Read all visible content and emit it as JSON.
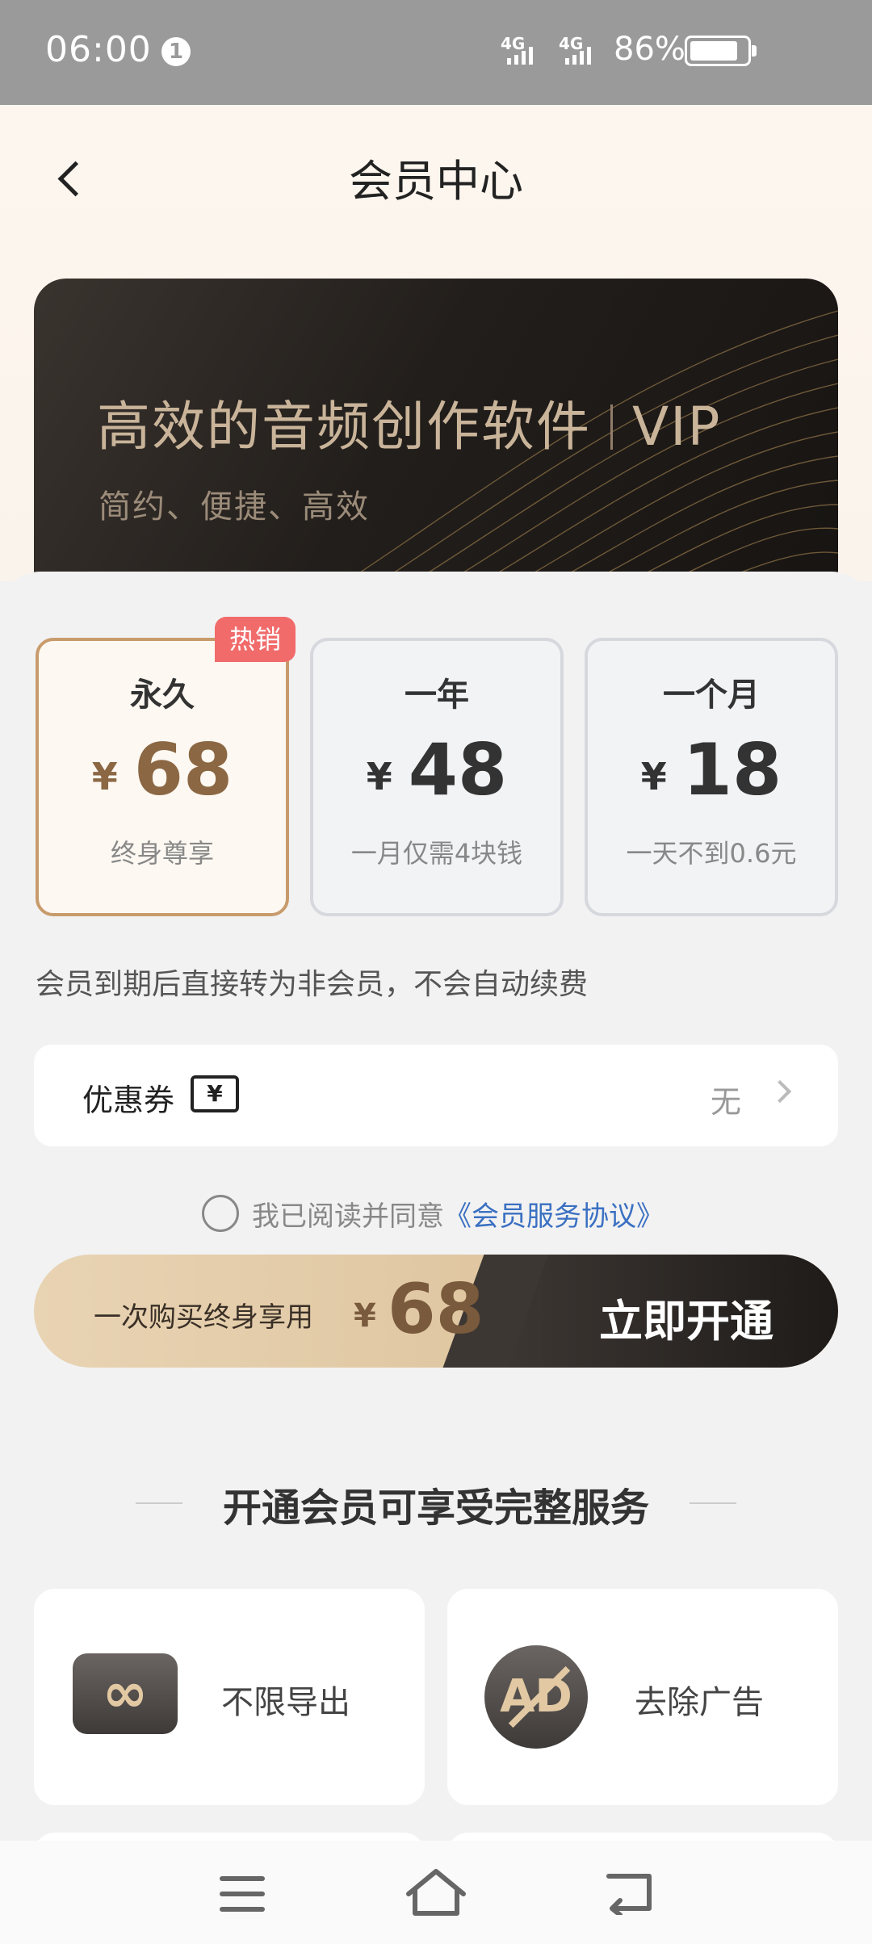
{
  "status_bar": {
    "time": "06:00",
    "notification_count": "1",
    "network1": "4G",
    "network2": "4G",
    "battery_percent": "86%",
    "battery_level": 0.86
  },
  "header": {
    "title": "会员中心"
  },
  "banner": {
    "title": "高效的音频创作软件",
    "badge": "VIP",
    "subtitle": "简约、便捷、高效"
  },
  "plans": [
    {
      "name": "永久",
      "currency": "¥",
      "price": "68",
      "desc": "终身尊享",
      "badge": "热销",
      "selected": true
    },
    {
      "name": "一年",
      "currency": "¥",
      "price": "48",
      "desc": "一月仅需4块钱",
      "selected": false
    },
    {
      "name": "一个月",
      "currency": "¥",
      "price": "18",
      "desc": "一天不到0.6元",
      "selected": false
    }
  ],
  "notice": "会员到期后直接转为非会员，不会自动续费",
  "coupon": {
    "label": "优惠券",
    "icon_symbol": "¥",
    "value": "无"
  },
  "agreement": {
    "text": "我已阅读并同意",
    "link": "《会员服务协议》"
  },
  "purchase": {
    "text": "一次购买终身享用",
    "currency": "¥",
    "price": "68",
    "button": "立即开通"
  },
  "benefits": {
    "title": "开通会员可享受完整服务",
    "items": [
      {
        "label": "不限导出",
        "icon": "infinity-icon"
      },
      {
        "label": "去除广告",
        "icon": "no-ad-icon"
      }
    ]
  },
  "colors": {
    "accent_gold": "#c89b6c",
    "hot_badge": "#f16b6b",
    "link": "#3a70c2",
    "dark_button": "#1e1b19"
  }
}
